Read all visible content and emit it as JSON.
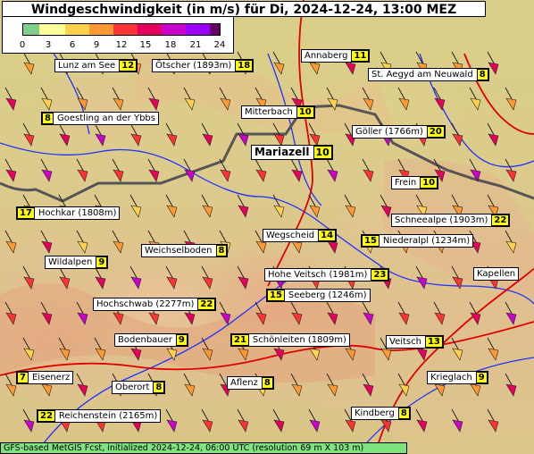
{
  "header": {
    "title": "Windgeschwindigkeit (in m/s) für Di, 2024-12-24, 13:00 MEZ"
  },
  "legend": {
    "ticks": [
      "0",
      "3",
      "6",
      "9",
      "12",
      "15",
      "18",
      "21",
      "24"
    ],
    "colors": [
      "#7fcf8f",
      "#ffff99",
      "#ffd24d",
      "#ff9933",
      "#ff3333",
      "#e6005c",
      "#cc00cc",
      "#9900ff",
      "#660066"
    ]
  },
  "locations": [
    {
      "name": "Lunz am See",
      "value": "12"
    },
    {
      "name": "Ötscher (1893m)",
      "value": "18"
    },
    {
      "name": "Annaberg",
      "value": "11"
    },
    {
      "name": "St. Aegyd am Neuwald",
      "value": "8"
    },
    {
      "name": "Goestling an der Ybbs",
      "value": "8"
    },
    {
      "name": "Mitterbach",
      "value": "10"
    },
    {
      "name": "Göller (1766m)",
      "value": "20"
    },
    {
      "name": "Mariazell",
      "value": "10"
    },
    {
      "name": "Frein",
      "value": "10"
    },
    {
      "name": "Hochkar (1808m)",
      "value": "17"
    },
    {
      "name": "Schneealpe (1903m)",
      "value": "22"
    },
    {
      "name": "Wegscheid",
      "value": "14"
    },
    {
      "name": "Niederalpl (1234m)",
      "value": "15"
    },
    {
      "name": "Weichselboden",
      "value": "8"
    },
    {
      "name": "Wildalpen",
      "value": "9"
    },
    {
      "name": "Hohe Veitsch (1981m)",
      "value": "23"
    },
    {
      "name": "Kapellen",
      "value": ""
    },
    {
      "name": "Seeberg (1246m)",
      "value": "15"
    },
    {
      "name": "Hochschwab (2277m)",
      "value": "22"
    },
    {
      "name": "Bodenbauer",
      "value": "9"
    },
    {
      "name": "Schönleiten (1809m)",
      "value": "21"
    },
    {
      "name": "Veitsch",
      "value": "13"
    },
    {
      "name": "Eisenerz",
      "value": "7"
    },
    {
      "name": "Oberort",
      "value": "8"
    },
    {
      "name": "Aflenz",
      "value": "8"
    },
    {
      "name": "Krieglach",
      "value": "9"
    },
    {
      "name": "Reichenstein (2165m)",
      "value": "22"
    },
    {
      "name": "Kindberg",
      "value": "8"
    }
  ],
  "footer": {
    "text": "GFS-based MetGIS Fcst, initialized 2024-12-24, 06:00 UTC  (resolution 69 m X 103 m)"
  }
}
